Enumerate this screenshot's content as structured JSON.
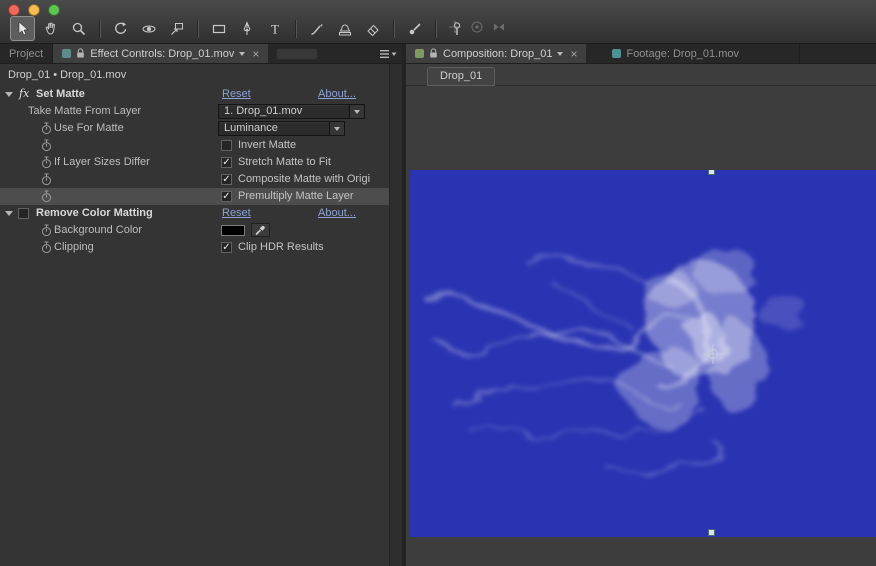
{
  "colors": {
    "screen_blue": "#2a34b2",
    "link_blue": "#8fa2d4",
    "background_color_swatch": "#000000"
  },
  "toolbar": {
    "tools": [
      {
        "name": "selection",
        "active": true
      },
      {
        "name": "hand",
        "active": false
      },
      {
        "name": "zoom",
        "active": false
      },
      {
        "name": "rotation",
        "active": false
      },
      {
        "name": "unified-camera",
        "active": false
      },
      {
        "name": "pan-behind",
        "active": false
      },
      {
        "name": "rectangle",
        "active": false
      },
      {
        "name": "pen",
        "active": false
      },
      {
        "name": "type",
        "active": false
      },
      {
        "name": "brush",
        "active": false
      },
      {
        "name": "clone-stamp",
        "active": false
      },
      {
        "name": "eraser",
        "active": false
      },
      {
        "name": "roto-brush",
        "active": false
      },
      {
        "name": "puppet-pin",
        "active": false
      }
    ]
  },
  "left_panel": {
    "tabs": {
      "project": "Project",
      "effect_controls": "Effect Controls: Drop_01.mov"
    },
    "header": "Drop_01 • Drop_01.mov",
    "set_matte": {
      "fx_badge": "fx",
      "name": "Set Matte",
      "reset": "Reset",
      "about": "About...",
      "take_matte_label": "Take Matte From Layer",
      "take_matte_value": "1. Drop_01.mov",
      "use_for_matte_label": "Use For Matte",
      "use_for_matte_value": "Luminance",
      "invert_label": "Invert Matte",
      "invert_checked": false,
      "sizes_differ_label": "If Layer Sizes Differ",
      "sizes_differ_value": "Stretch Matte to Fit",
      "sizes_differ_checked": true,
      "composite_value": "Composite Matte with Origi",
      "composite_checked": true,
      "premultiply_value": "Premultiply Matte Layer",
      "premultiply_checked": true,
      "premultiply_highlighted": true
    },
    "remove_color_matting": {
      "name": "Remove Color Matting",
      "reset": "Reset",
      "about": "About...",
      "enabled_checked": false,
      "background_color_label": "Background Color",
      "clipping_label": "Clipping",
      "clipping_value": "Clip HDR Results",
      "clipping_checked": true
    }
  },
  "right_panel": {
    "tabs": {
      "composition": "Composition: Drop_01",
      "footage": "Footage: Drop_01.mov"
    },
    "viewer_tab": "Drop_01"
  }
}
